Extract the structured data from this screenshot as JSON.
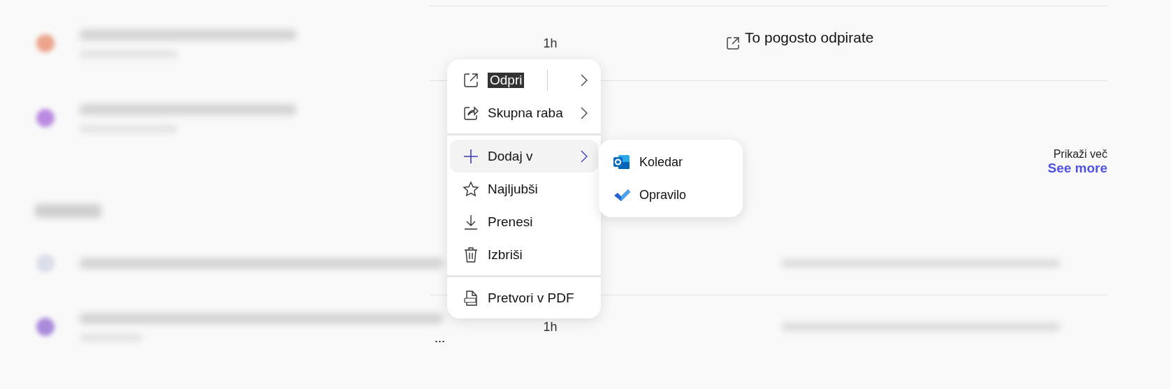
{
  "recent_rows": [
    {
      "color": "#eba58c",
      "time": "1h",
      "reason": "To pogosto odpirate"
    },
    {
      "color": "#b98ae0"
    }
  ],
  "see_more": {
    "label": "Prikaži več",
    "link": "See more"
  },
  "shared_rows": [
    {
      "color": "#dadeea"
    },
    {
      "color": "#a98adb",
      "time": "1h",
      "ellipsis": "..."
    }
  ],
  "menu": {
    "groups": [
      [
        {
          "label": "Odpri",
          "inverse": true,
          "split": true,
          "submenu": true,
          "selected": false
        },
        {
          "label": "Skupna raba",
          "inverse": false,
          "split": false,
          "submenu": true,
          "selected": false
        }
      ],
      [
        {
          "label": "Dodaj v",
          "inverse": false,
          "split": false,
          "submenu": true,
          "selected": true
        },
        {
          "label": "Najljubši",
          "inverse": false,
          "split": false,
          "submenu": false,
          "selected": false
        },
        {
          "label": "Prenesi",
          "inverse": false,
          "split": false,
          "submenu": false,
          "selected": false
        },
        {
          "label": "Izbriši",
          "inverse": false,
          "split": false,
          "submenu": false,
          "selected": false
        }
      ],
      [
        {
          "label": "Pretvori v PDF",
          "inverse": false,
          "split": false,
          "submenu": false,
          "selected": false
        }
      ]
    ]
  },
  "submenu": {
    "items": [
      {
        "label": "Koledar"
      },
      {
        "label": "Opravilo"
      }
    ]
  }
}
